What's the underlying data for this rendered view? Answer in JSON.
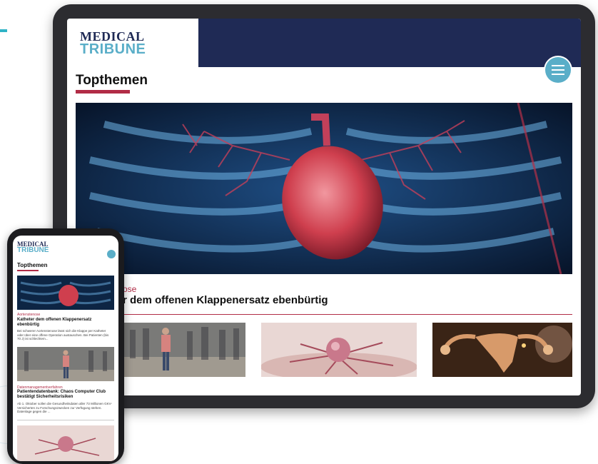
{
  "tablet": {
    "logo": {
      "line1": "MEDICAL",
      "line2": "TRIBUNE"
    },
    "menu_icon": "hamburger-menu-icon",
    "section_title": "Topthemen",
    "hero_image": "heart-anatomy-illustration",
    "article": {
      "kicker": "ose",
      "headline": "r dem offenen Klappenersatz ebenbürtig"
    },
    "thumbnails": [
      "crowd-street-photo",
      "cancer-cell-illustration",
      "uterus-anatomy-illustration"
    ]
  },
  "phone": {
    "logo": {
      "line1": "MEDICAL",
      "line2": "TRIBUNE"
    },
    "section_title": "Topthemen",
    "articles": [
      {
        "kicker": "Aortenstenose",
        "headline": "Katheter dem offenen Klappenersatz ebenbürtig",
        "body": "Bei schwerer Aortenstenose lässt sich die Klappe per Katheter oder über eine offene Operation austauschen. Bei Patienten (bis 70 J) ist schlechtem..."
      },
      {
        "kicker": "Datenmanagementverfahren",
        "headline": "Patientendatenbank: Chaos Computer Club bestätigt Sicherheitsrisiken",
        "body": "Ab 1. Oktober sollen die Gesundheitsdaten aller 73 Millionen GKV-Versicherten zu Forschungszwecken zur Verfügung stehen. Datenlage gegen die ..."
      }
    ]
  },
  "colors": {
    "navy": "#1f2a55",
    "teal": "#5aaec8",
    "crimson": "#b12c46"
  }
}
